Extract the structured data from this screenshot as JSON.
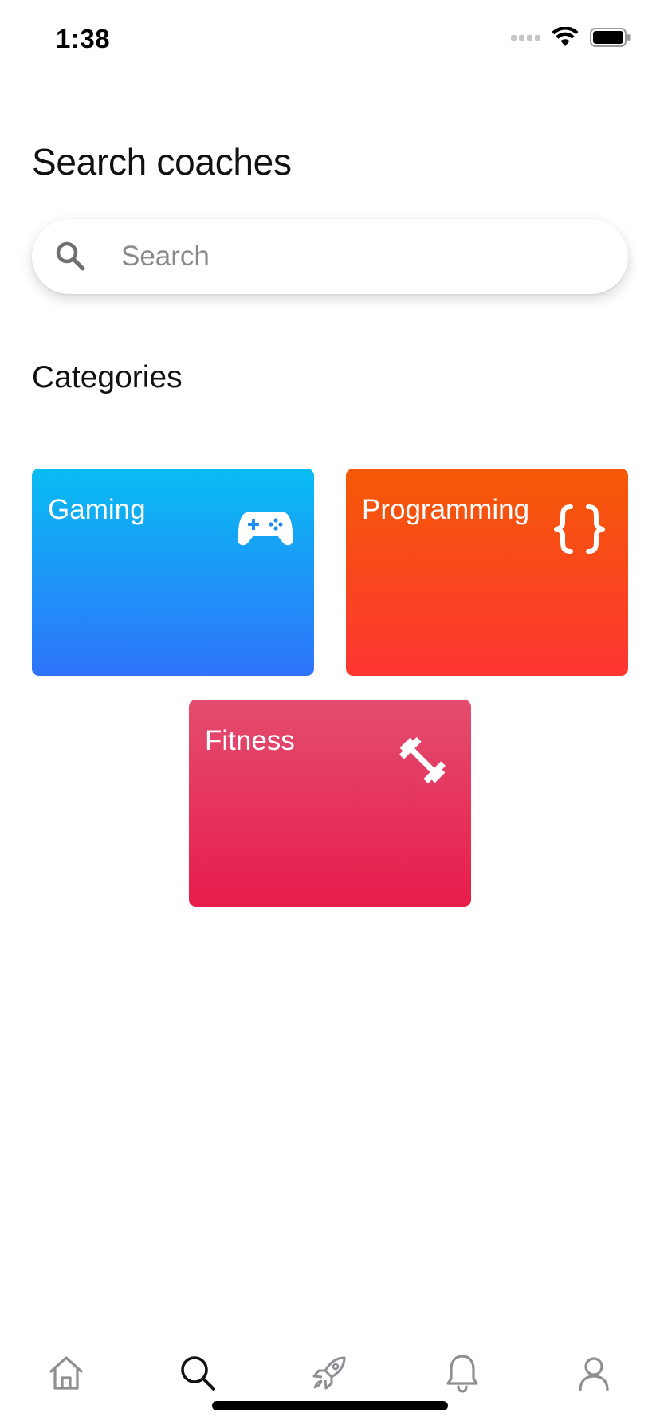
{
  "status_bar": {
    "time": "1:38"
  },
  "header": {
    "title": "Search coaches"
  },
  "search": {
    "placeholder": "Search",
    "value": ""
  },
  "categories": {
    "title": "Categories",
    "items": [
      {
        "label": "Gaming",
        "icon": "gamepad-icon",
        "gradient": [
          "#08bdf2",
          "#2f73fb"
        ]
      },
      {
        "label": "Programming",
        "icon": "code-braces-icon",
        "gradient": [
          "#f45a06",
          "#fe3632"
        ]
      },
      {
        "label": "Fitness",
        "icon": "dumbbell-icon",
        "gradient": [
          "#e34d70",
          "#e81c4b"
        ]
      }
    ]
  },
  "tab_bar": {
    "items": [
      {
        "icon": "home-icon",
        "active": false
      },
      {
        "icon": "search-icon",
        "active": true
      },
      {
        "icon": "rocket-icon",
        "active": false
      },
      {
        "icon": "bell-icon",
        "active": false
      },
      {
        "icon": "user-icon",
        "active": false
      }
    ],
    "active_color": "#111111",
    "inactive_color": "#8e8e93"
  }
}
